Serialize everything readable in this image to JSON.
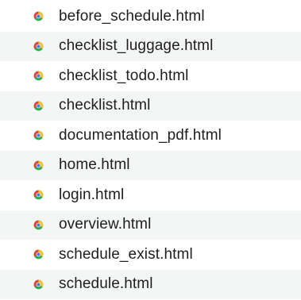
{
  "files": [
    {
      "name": "before_schedule.html",
      "icon": "chrome-html-file-icon"
    },
    {
      "name": "checklist_luggage.html",
      "icon": "chrome-html-file-icon"
    },
    {
      "name": "checklist_todo.html",
      "icon": "chrome-html-file-icon"
    },
    {
      "name": "checklist.html",
      "icon": "chrome-html-file-icon"
    },
    {
      "name": "documentation_pdf.html",
      "icon": "chrome-html-file-icon"
    },
    {
      "name": "home.html",
      "icon": "chrome-html-file-icon"
    },
    {
      "name": "login.html",
      "icon": "chrome-html-file-icon"
    },
    {
      "name": "overview.html",
      "icon": "chrome-html-file-icon"
    },
    {
      "name": "schedule_exist.html",
      "icon": "chrome-html-file-icon"
    },
    {
      "name": "schedule.html",
      "icon": "chrome-html-file-icon"
    }
  ],
  "colors": {
    "icon_red": "#e4453a",
    "icon_yellow": "#f6c22c",
    "icon_green": "#32a853",
    "icon_center": "#3e7fe0",
    "row_stripe": "#f4f5f5",
    "text": "#1e1e1e"
  }
}
